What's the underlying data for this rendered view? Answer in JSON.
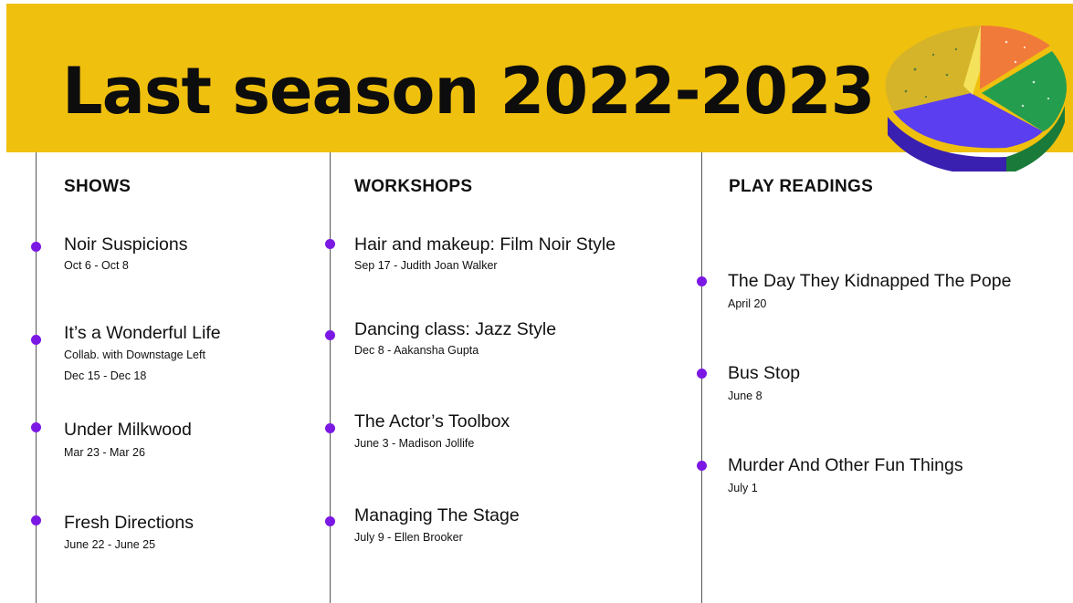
{
  "title": "Last season 2022-2023",
  "colors": {
    "banner": "#f0c00e",
    "dot": "#7b18e3",
    "line": "#555555"
  },
  "decoration": "3d-pie-chart-icon",
  "columns": [
    {
      "heading": "SHOWS",
      "items": [
        {
          "title": "Noir Suspicions",
          "lines": [
            "Oct 6 - Oct 8"
          ]
        },
        {
          "title": "It’s a Wonderful Life",
          "lines": [
            "Collab. with Downstage Left",
            "Dec 15 - Dec 18"
          ]
        },
        {
          "title": "Under Milkwood",
          "lines": [
            "Mar 23 - Mar 26"
          ]
        },
        {
          "title": "Fresh Directions",
          "lines": [
            "June 22 - June 25"
          ]
        }
      ]
    },
    {
      "heading": "WORKSHOPS",
      "items": [
        {
          "title": "Hair and makeup: Film Noir Style",
          "lines": [
            "Sep 17 - Judith Joan Walker"
          ]
        },
        {
          "title": "Dancing class: Jazz Style",
          "lines": [
            "Dec 8 - Aakansha Gupta"
          ]
        },
        {
          "title": "The Actor’s Toolbox",
          "lines": [
            "June 3 - Madison Jollife"
          ]
        },
        {
          "title": "Managing The Stage",
          "lines": [
            "July 9 - Ellen Brooker"
          ]
        }
      ]
    },
    {
      "heading": "PLAY READINGS",
      "items": [
        {
          "title": "The Day They Kidnapped The Pope",
          "lines": [
            "April 20"
          ]
        },
        {
          "title": "Bus Stop",
          "lines": [
            "June 8"
          ]
        },
        {
          "title": "Murder And Other Fun Things",
          "lines": [
            "July 1"
          ]
        }
      ]
    }
  ]
}
